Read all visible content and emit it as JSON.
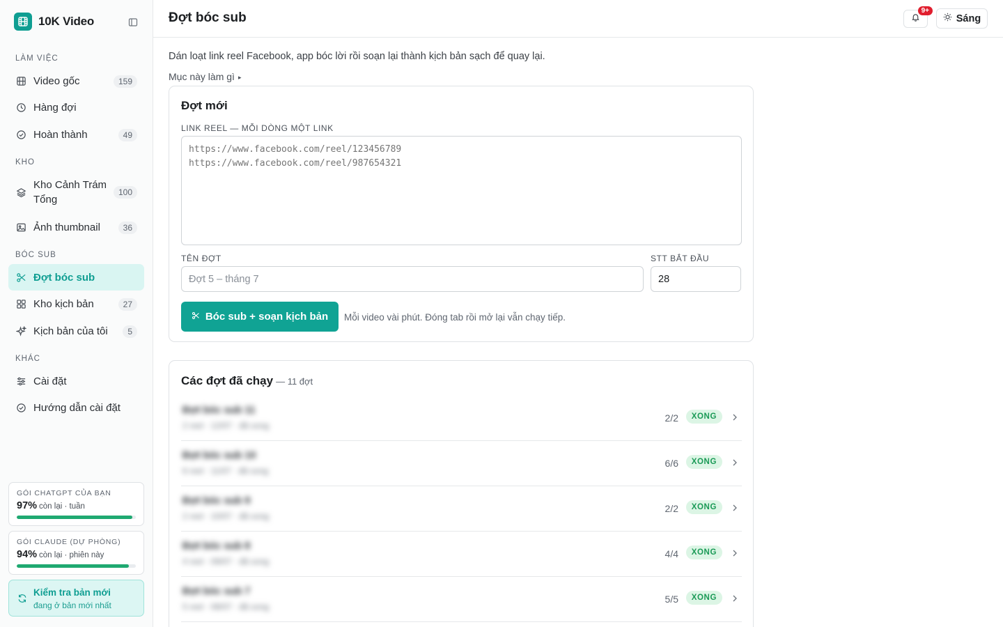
{
  "app": {
    "name": "10K Video"
  },
  "sidebar": {
    "sections": [
      {
        "label": "LÀM VIỆC"
      },
      {
        "label": "KHO"
      },
      {
        "label": "BÓC SUB"
      },
      {
        "label": "KHÁC"
      }
    ],
    "items": [
      {
        "label": "Video gốc",
        "count": "159",
        "icon": "film-icon"
      },
      {
        "label": "Hàng đợi",
        "count": "",
        "icon": "clock-icon"
      },
      {
        "label": "Hoàn thành",
        "count": "49",
        "icon": "check-circle-icon"
      },
      {
        "label": "Kho Cảnh Trám Tổng",
        "count": "100",
        "icon": "layers-icon"
      },
      {
        "label": "Ảnh thumbnail",
        "count": "36",
        "icon": "image-icon"
      },
      {
        "label": "Đợt bóc sub",
        "count": "",
        "icon": "scissors-icon",
        "active": true
      },
      {
        "label": "Kho kịch bản",
        "count": "27",
        "icon": "grid-icon"
      },
      {
        "label": "Kịch bản của tôi",
        "count": "5",
        "icon": "sparkles-icon"
      },
      {
        "label": "Cài đặt",
        "count": "",
        "icon": "sliders-icon"
      },
      {
        "label": "Hướng dẫn cài đặt",
        "count": "",
        "icon": "check-circle-icon"
      }
    ],
    "quotas": [
      {
        "title": "GÓI CHATGPT CỦA BẠN",
        "percent": "97%",
        "suffix": "còn lại · tuần",
        "fill": 0.97
      },
      {
        "title": "GÓI CLAUDE (DỰ PHÒNG)",
        "percent": "94%",
        "suffix": "còn lại · phiên này",
        "fill": 0.94
      }
    ],
    "update": {
      "title": "Kiểm tra bản mới",
      "subtitle": "đang ở bản mới nhất"
    }
  },
  "header": {
    "title": "Đợt bóc sub",
    "notification_badge": "9+",
    "theme_label": "Sáng"
  },
  "main": {
    "intro": "Dán loạt link reel Facebook, app bóc lời rồi soạn lại thành kịch bản sạch để quay lại.",
    "help_toggle": "Mục này làm gì",
    "new_batch": {
      "title": "Đợt mới",
      "links_label": "LINK REEL — MỖI DÒNG MỘT LINK",
      "links_placeholder": "https://www.facebook.com/reel/123456789\nhttps://www.facebook.com/reel/987654321",
      "name_label": "TÊN ĐỢT",
      "name_placeholder": "Đợt 5 – tháng 7",
      "start_label": "STT BẮT ĐẦU",
      "start_value": "28",
      "run_button": "Bóc sub + soạn kịch bản",
      "run_note": "Mỗi video vài phút. Đóng tab rồi mở lại vẫn chạy tiếp."
    },
    "history": {
      "title": "Các đợt đã chạy",
      "subtitle": "— 11 đợt",
      "rows": [
        {
          "name": "Đợt bóc sub 11",
          "meta": "2 reel · 12/07 · đã xong",
          "progress": "2/2",
          "status": "XONG"
        },
        {
          "name": "Đợt bóc sub 10",
          "meta": "6 reel · 11/07 · đã xong",
          "progress": "6/6",
          "status": "XONG"
        },
        {
          "name": "Đợt bóc sub 9",
          "meta": "2 reel · 10/07 · đã xong",
          "progress": "2/2",
          "status": "XONG"
        },
        {
          "name": "Đợt bóc sub 8",
          "meta": "4 reel · 09/07 · đã xong",
          "progress": "4/4",
          "status": "XONG"
        },
        {
          "name": "Đợt bóc sub 7",
          "meta": "5 reel · 08/07 · đã xong",
          "progress": "5/5",
          "status": "XONG"
        }
      ]
    }
  },
  "colors": {
    "accent": "#10a394",
    "success": "#1a9a56",
    "badge": "#e01e2e"
  }
}
